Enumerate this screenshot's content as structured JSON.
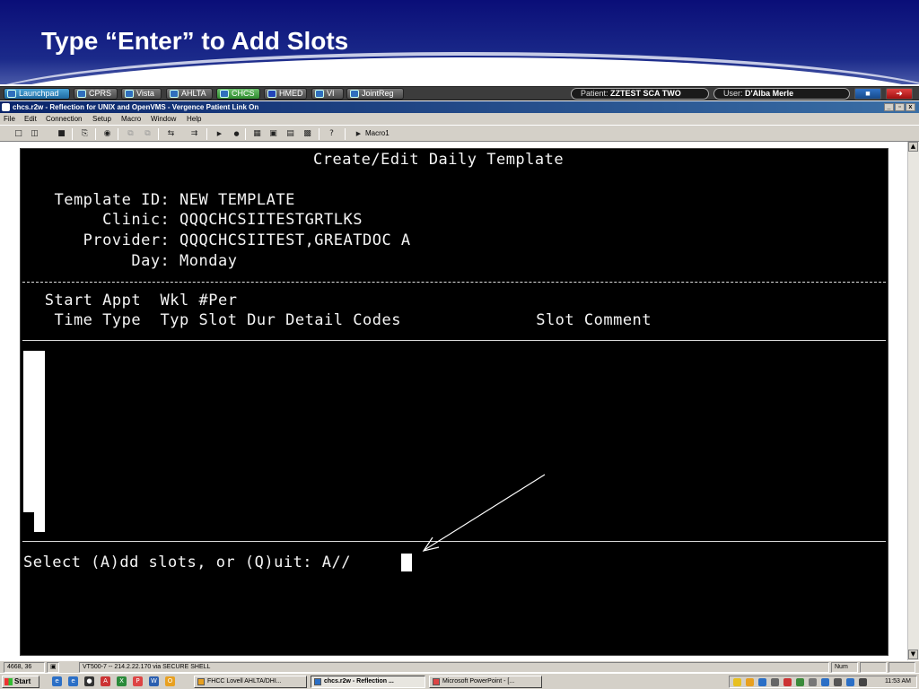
{
  "slide": {
    "title": "Type “Enter” to Add Slots"
  },
  "appbar": {
    "buttons": [
      {
        "label": "Launchpad"
      },
      {
        "label": "CPRS"
      },
      {
        "label": "Vista"
      },
      {
        "label": "AHLTA"
      },
      {
        "label": "CHCS"
      },
      {
        "label": "HMED"
      },
      {
        "label": "VI"
      },
      {
        "label": "JointReg"
      }
    ],
    "patient_label": "Patient:",
    "patient_name": "ZZTEST SCA TWO",
    "user_label": "User:",
    "user_name": "D'Alba Merle"
  },
  "window": {
    "title": "chcs.r2w - Reflection for UNIX and OpenVMS - Vergence Patient Link On",
    "controls": [
      "_",
      "▫",
      "x"
    ]
  },
  "menu": [
    "File",
    "Edit",
    "Connection",
    "Setup",
    "Macro",
    "Window",
    "Help"
  ],
  "toolbar": {
    "macro_label": "Macro1"
  },
  "terminal": {
    "heading": "Create/Edit Daily Template",
    "template_id_line": "  Template ID: NEW TEMPLATE",
    "clinic_line": "       Clinic: QQQCHCSIITESTGRTLKS",
    "provider_line": "     Provider: QQQCHCSIITEST,GREATDOC A",
    "day_line": "          Day: Monday",
    "col_header_1": " Start Appt  Wkl #Per",
    "col_header_2": "  Time Type  Typ Slot Dur Detail Codes              Slot Comment",
    "prompt": "Select (A)dd slots, or (Q)uit: A//"
  },
  "statusbar": {
    "position": "4668, 36",
    "connection": "VT500-7 -- 214.2.22.170 via SECURE SHELL",
    "num": "Num"
  },
  "taskbar": {
    "start": "Start",
    "tasks": [
      {
        "label": "FHCC Lovell AHLTA/DHI..."
      },
      {
        "label": "chcs.r2w - Reflection ..."
      },
      {
        "label": "Microsoft PowerPoint - [..."
      }
    ],
    "clock": "11:53 AM"
  },
  "colors": {
    "header_blue": "#0a0e78",
    "terminal_bg": "#000000",
    "terminal_fg": "#f4f4f4"
  }
}
